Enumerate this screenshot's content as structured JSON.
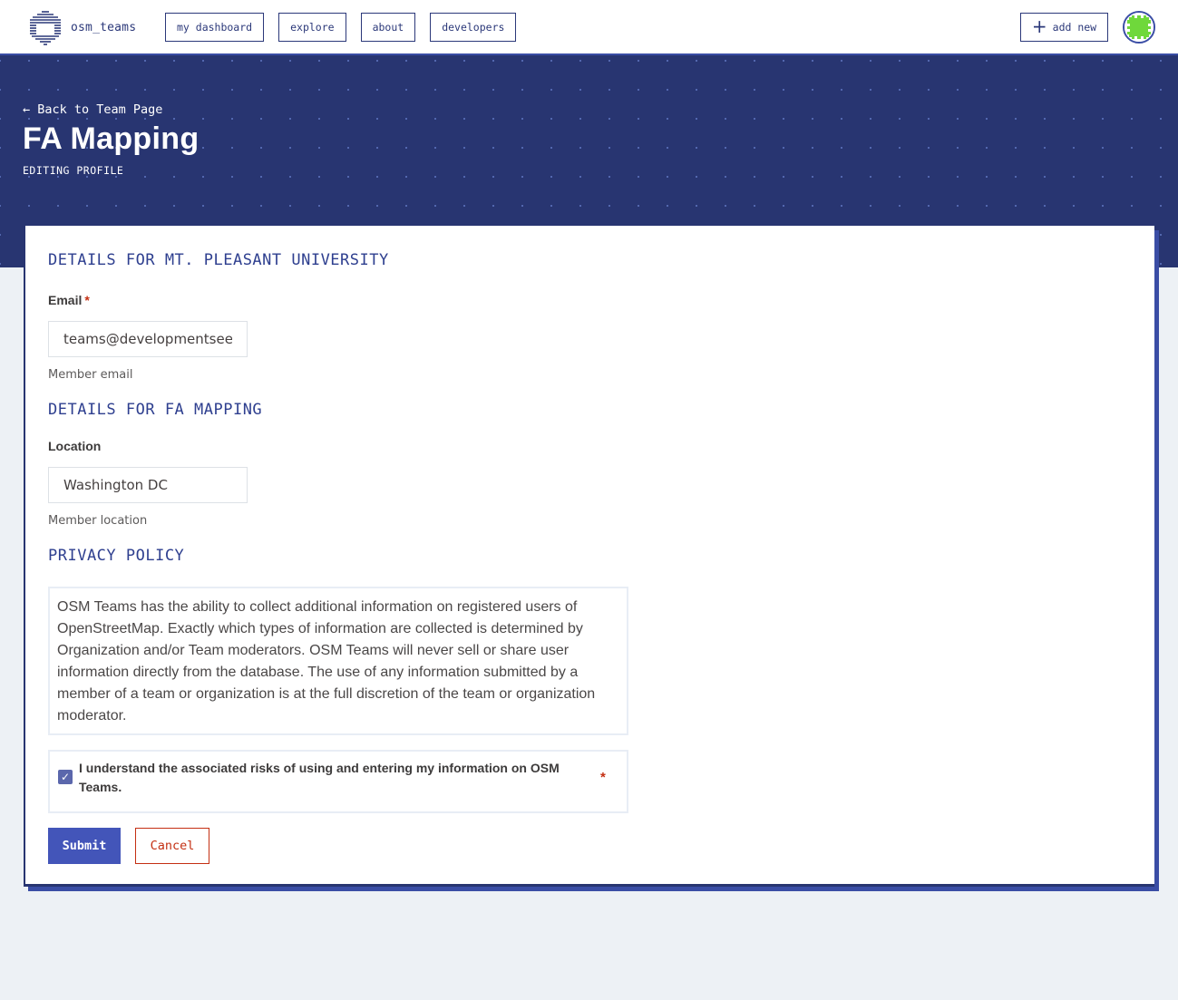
{
  "header": {
    "brand_name": "osm_teams",
    "nav": [
      {
        "label": "my dashboard"
      },
      {
        "label": "explore"
      },
      {
        "label": "about"
      },
      {
        "label": "developers"
      }
    ],
    "add_new_label": "add new",
    "add_new_icon": "plus-icon",
    "avatar_icon": "user-avatar-identicon"
  },
  "hero": {
    "back_link": "← Back to Team Page",
    "title": "FA Mapping",
    "subtitle": "EDITING PROFILE"
  },
  "form": {
    "org_section_heading": "DETAILS FOR MT. PLEASANT UNIVERSITY",
    "email": {
      "label": "Email",
      "required_marker": "*",
      "value": "teams@developmentseed.org",
      "help": "Member email"
    },
    "team_section_heading": "DETAILS FOR FA MAPPING",
    "location": {
      "label": "Location",
      "value": "Washington DC",
      "help": "Member location"
    },
    "privacy_heading": "PRIVACY POLICY",
    "privacy_text": "OSM Teams has the ability to collect additional information on registered users of OpenStreetMap. Exactly which types of information are collected is determined by Organization and/or Team moderators. OSM Teams will never sell or share user information directly from the database. The use of any information submitted by a member of a team or organization is at the full discretion of the team or organization moderator.",
    "agreement": {
      "label": "I understand the associated risks of using and entering my information on OSM Teams.",
      "checked": true,
      "check_glyph": "✓",
      "required_marker": "*"
    },
    "submit_label": "Submit",
    "cancel_label": "Cancel"
  },
  "colors": {
    "brand_navy": "#283571",
    "primary_blue": "#4355b9",
    "danger_red": "#c42f12",
    "page_background": "#edf1f5"
  }
}
